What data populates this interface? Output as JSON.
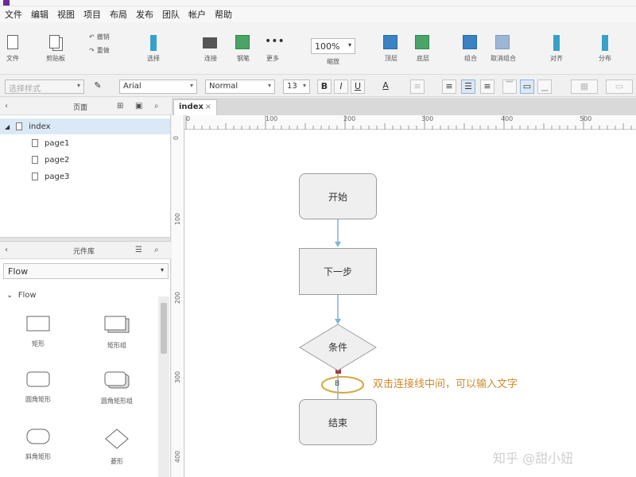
{
  "menu": [
    "文件",
    "编辑",
    "视图",
    "项目",
    "布局",
    "发布",
    "团队",
    "帐户",
    "帮助"
  ],
  "toolbar": {
    "file_label": "文件",
    "clipboard_label": "剪贴板",
    "undo_label": "撤销",
    "redo_label": "重做",
    "select_label": "选择",
    "connect_label": "连接",
    "pen_label": "钢笔",
    "more_label": "更多",
    "zoom_value": "100%",
    "zoom_label": "缩放",
    "top_label": "顶层",
    "bottom_label": "底层",
    "combine_label": "组合",
    "ungroup_label": "取消组合",
    "align_label": "对齐",
    "distribute_label": "分布"
  },
  "format": {
    "style_placeholder": "选择样式",
    "font": "Arial",
    "weight": "Normal",
    "size": "13",
    "bold": "B",
    "italic": "I",
    "underline": "U",
    "font_color": "A"
  },
  "pages_panel": {
    "title": "页面",
    "root": "index",
    "children": [
      "page1",
      "page2",
      "page3"
    ]
  },
  "library_panel": {
    "title": "元件库",
    "selected_library": "Flow",
    "group": "Flow",
    "widgets": [
      "矩形",
      "矩形组",
      "圆角矩形",
      "圆角矩形组",
      "斜角矩形",
      "菱形"
    ]
  },
  "canvas": {
    "tab": "index",
    "ruler_h": [
      "0",
      "100",
      "200",
      "300",
      "400",
      "500"
    ],
    "ruler_v": [
      "0",
      "100",
      "200",
      "300",
      "400"
    ],
    "nodes": {
      "start": "开始",
      "next": "下一步",
      "condition": "条件",
      "end": "结束"
    },
    "connector_label": "B",
    "annotation": "双击连接线中间，可以输入文字"
  },
  "watermark": "知乎 @甜小妞",
  "colors": {
    "accent": "#3a82c4",
    "connector": "#7ab8d6",
    "annotation": "#d08a2e",
    "handle": "#a83a3a"
  }
}
